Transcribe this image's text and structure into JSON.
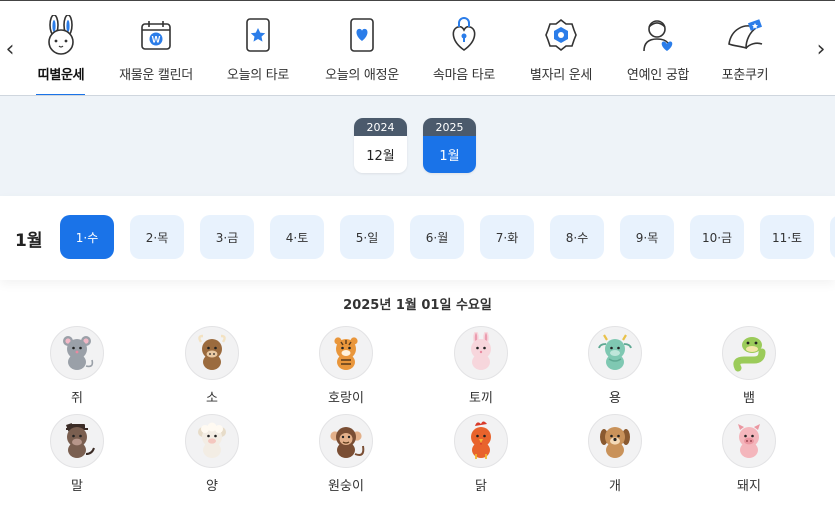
{
  "nav": {
    "items": [
      {
        "label": "띠별운세",
        "icon": "rabbit-icon",
        "active": true
      },
      {
        "label": "재물운 캘린더",
        "icon": "calendar-coin-icon"
      },
      {
        "label": "오늘의 타로",
        "icon": "tarot-star-card-icon"
      },
      {
        "label": "오늘의 애정운",
        "icon": "tarot-heart-card-icon"
      },
      {
        "label": "속마음 타로",
        "icon": "heart-lock-icon"
      },
      {
        "label": "별자리 운세",
        "icon": "constellation-icon"
      },
      {
        "label": "연예인 궁합",
        "icon": "person-heart-icon"
      },
      {
        "label": "포춘쿠키",
        "icon": "fortune-cookie-icon"
      }
    ],
    "prev_icon": "chevron-left-icon",
    "next_icon": "chevron-right-icon"
  },
  "months": [
    {
      "year": "2024",
      "month": "12월",
      "selected": false
    },
    {
      "year": "2025",
      "month": "1월",
      "selected": true
    }
  ],
  "day_strip": {
    "month_label": "1월",
    "days": [
      "1·수",
      "2·목",
      "3·금",
      "4·토",
      "5·일",
      "6·월",
      "7·화",
      "8·수",
      "9·목",
      "10·금",
      "11·토"
    ],
    "selected_index": 0
  },
  "date_heading": "2025년 1월 01일 수요일",
  "zodiac": [
    {
      "name": "쥐",
      "icon": "rat-icon"
    },
    {
      "name": "소",
      "icon": "ox-icon"
    },
    {
      "name": "호랑이",
      "icon": "tiger-icon"
    },
    {
      "name": "토끼",
      "icon": "rabbit-icon"
    },
    {
      "name": "용",
      "icon": "dragon-icon"
    },
    {
      "name": "뱀",
      "icon": "snake-icon"
    },
    {
      "name": "말",
      "icon": "horse-icon"
    },
    {
      "name": "양",
      "icon": "sheep-icon"
    },
    {
      "name": "원숭이",
      "icon": "monkey-icon"
    },
    {
      "name": "닭",
      "icon": "rooster-icon"
    },
    {
      "name": "개",
      "icon": "dog-icon"
    },
    {
      "name": "돼지",
      "icon": "pig-icon"
    }
  ],
  "colors": {
    "accent": "#1a73e8",
    "year_header": "#4b5a6c",
    "band": "#eef3f8",
    "pill": "#e8f2fd"
  }
}
